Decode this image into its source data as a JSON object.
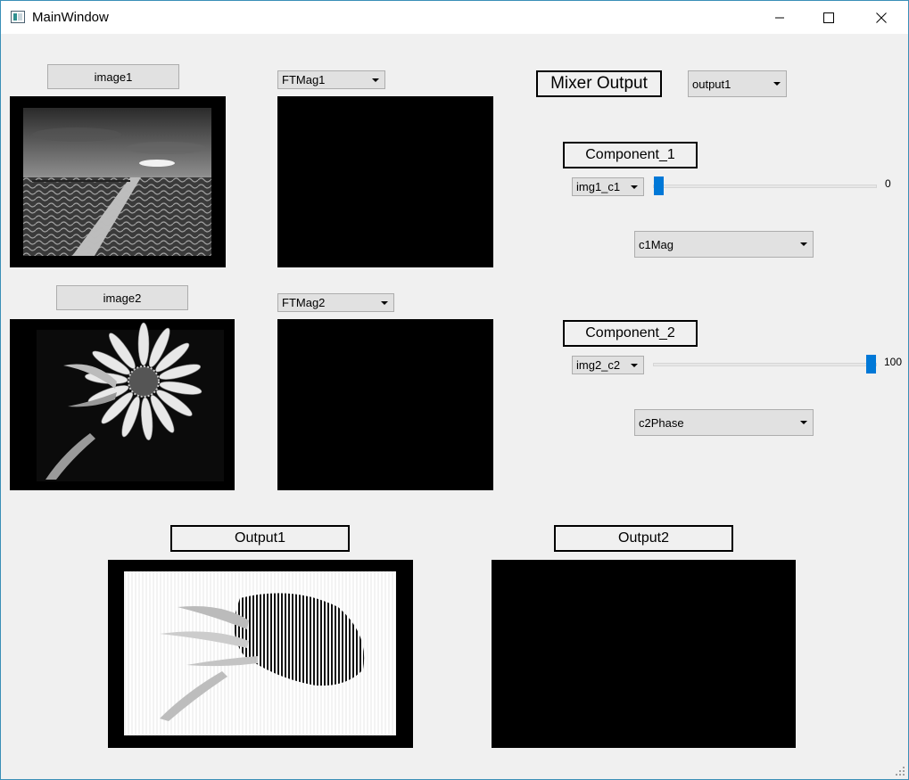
{
  "window": {
    "title": "MainWindow",
    "controls": {
      "minimize": "minimize-icon",
      "maximize": "maximize-icon",
      "close": "close-icon"
    }
  },
  "inputs": {
    "image1": {
      "button_label": "image1",
      "ft_selected": "FTMag1"
    },
    "image2": {
      "button_label": "image2",
      "ft_selected": "FTMag2"
    }
  },
  "mixer": {
    "title": "Mixer Output",
    "output_selected": "output1",
    "component1": {
      "title": "Component_1",
      "source_selected": "img1_c1",
      "slider_value": "0",
      "slider_fraction": 0,
      "type_selected": "c1Mag"
    },
    "component2": {
      "title": "Component_2",
      "source_selected": "img2_c2",
      "slider_value": "100",
      "slider_fraction": 1,
      "type_selected": "c2Phase"
    }
  },
  "outputs": {
    "output1_title": "Output1",
    "output2_title": "Output2"
  },
  "colors": {
    "accent": "#0078d7",
    "panel": "#000000",
    "window_bg": "#f0f0f0"
  }
}
